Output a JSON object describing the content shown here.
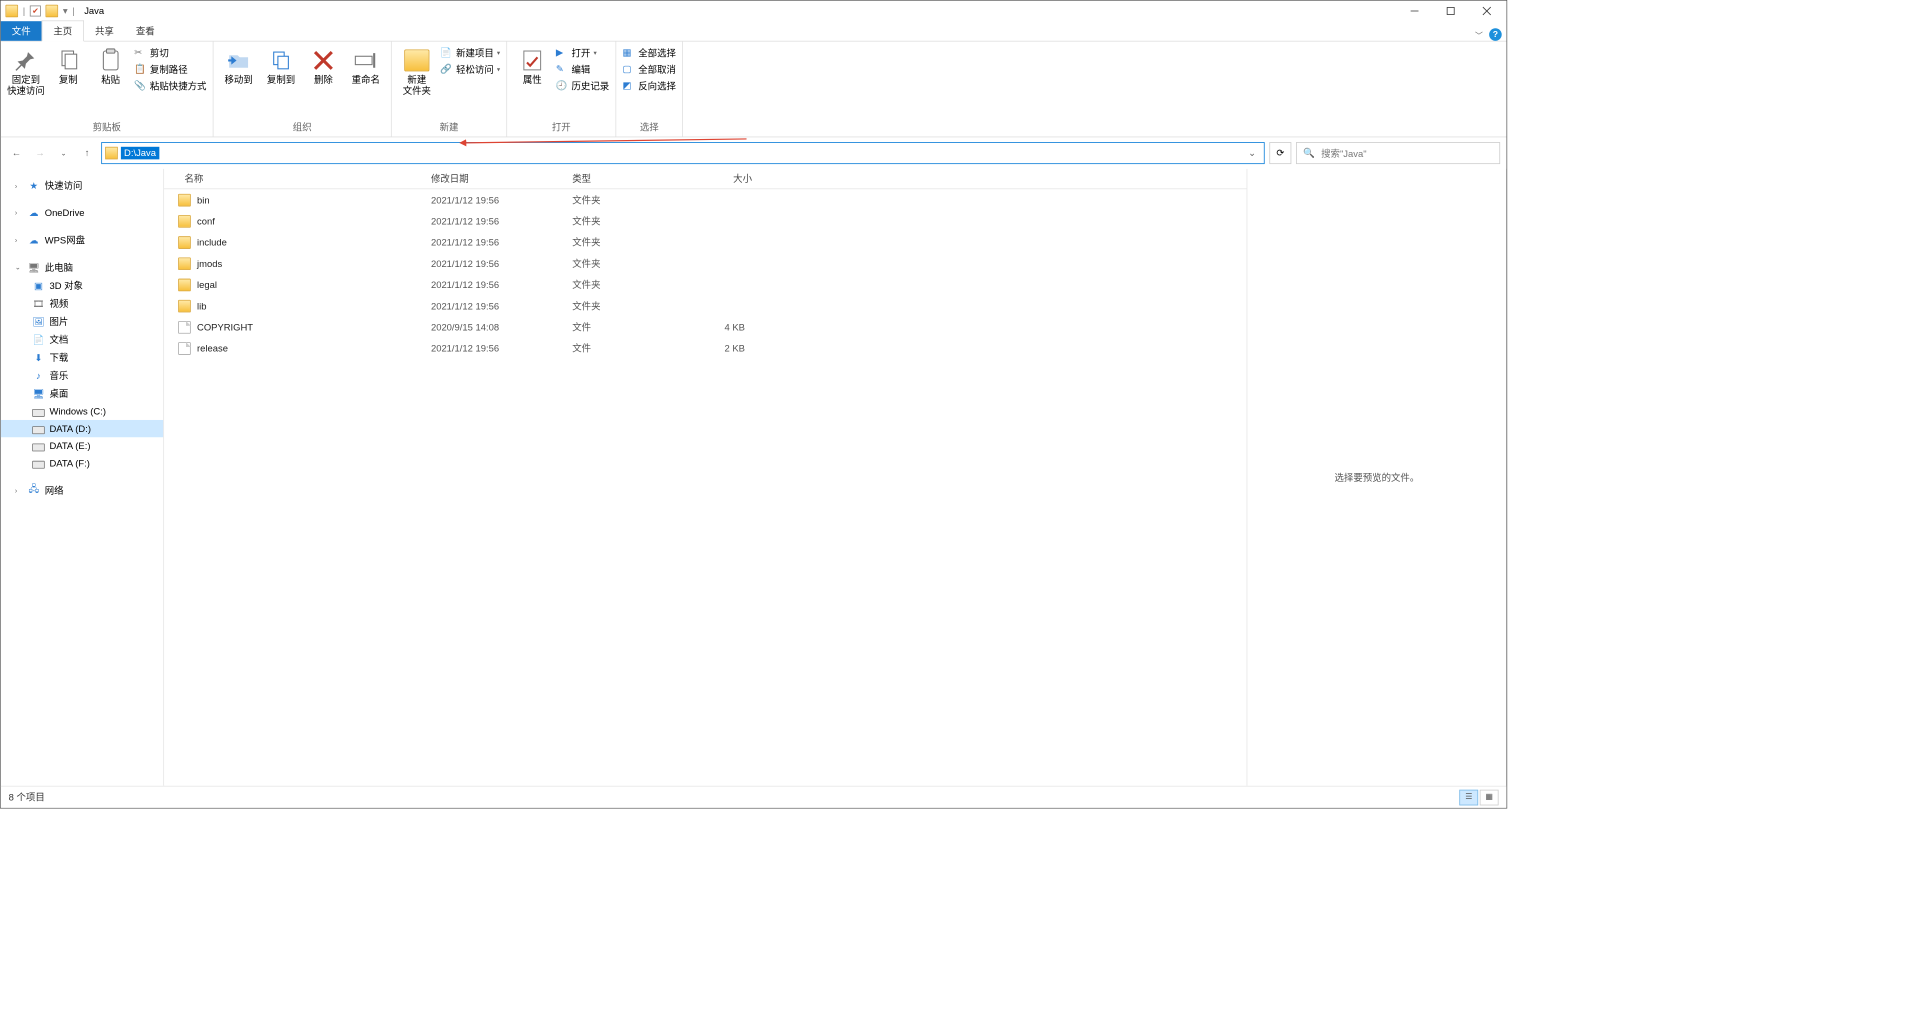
{
  "titlebar": {
    "title": "Java"
  },
  "menutabs": {
    "file": "文件",
    "home": "主页",
    "share": "共享",
    "view": "查看"
  },
  "ribbon": {
    "clipboard": {
      "pin": "固定到\n快速访问",
      "copy": "复制",
      "paste": "粘贴",
      "cut": "剪切",
      "copypath": "复制路径",
      "pasteshortcut": "粘贴快捷方式",
      "label": "剪贴板"
    },
    "organize": {
      "moveto": "移动到",
      "copyto": "复制到",
      "delete": "删除",
      "rename": "重命名",
      "label": "组织"
    },
    "new": {
      "newfolder": "新建\n文件夹",
      "newitem": "新建项目",
      "easyaccess": "轻松访问",
      "label": "新建"
    },
    "open": {
      "properties": "属性",
      "open": "打开",
      "edit": "编辑",
      "history": "历史记录",
      "label": "打开"
    },
    "select": {
      "selectall": "全部选择",
      "selectnone": "全部取消",
      "invert": "反向选择",
      "label": "选择"
    }
  },
  "nav": {
    "path": "D:\\Java",
    "search_placeholder": "搜索\"Java\""
  },
  "tree": {
    "quick": "快速访问",
    "onedrive": "OneDrive",
    "wps": "WPS网盘",
    "thispc": "此电脑",
    "objects3d": "3D 对象",
    "videos": "视频",
    "pictures": "图片",
    "documents": "文档",
    "downloads": "下载",
    "music": "音乐",
    "desktop": "桌面",
    "drives": [
      "Windows (C:)",
      "DATA (D:)",
      "DATA (E:)",
      "DATA (F:)"
    ],
    "network": "网络"
  },
  "columns": {
    "name": "名称",
    "date": "修改日期",
    "type": "类型",
    "size": "大小"
  },
  "files": [
    {
      "name": "bin",
      "date": "2021/1/12 19:56",
      "type": "文件夹",
      "size": "",
      "kind": "folder"
    },
    {
      "name": "conf",
      "date": "2021/1/12 19:56",
      "type": "文件夹",
      "size": "",
      "kind": "folder"
    },
    {
      "name": "include",
      "date": "2021/1/12 19:56",
      "type": "文件夹",
      "size": "",
      "kind": "folder"
    },
    {
      "name": "jmods",
      "date": "2021/1/12 19:56",
      "type": "文件夹",
      "size": "",
      "kind": "folder"
    },
    {
      "name": "legal",
      "date": "2021/1/12 19:56",
      "type": "文件夹",
      "size": "",
      "kind": "folder"
    },
    {
      "name": "lib",
      "date": "2021/1/12 19:56",
      "type": "文件夹",
      "size": "",
      "kind": "folder"
    },
    {
      "name": "COPYRIGHT",
      "date": "2020/9/15 14:08",
      "type": "文件",
      "size": "4 KB",
      "kind": "file"
    },
    {
      "name": "release",
      "date": "2021/1/12 19:56",
      "type": "文件",
      "size": "2 KB",
      "kind": "file"
    }
  ],
  "preview": {
    "hint": "选择要预览的文件。"
  },
  "status": {
    "count": "8 个项目"
  }
}
